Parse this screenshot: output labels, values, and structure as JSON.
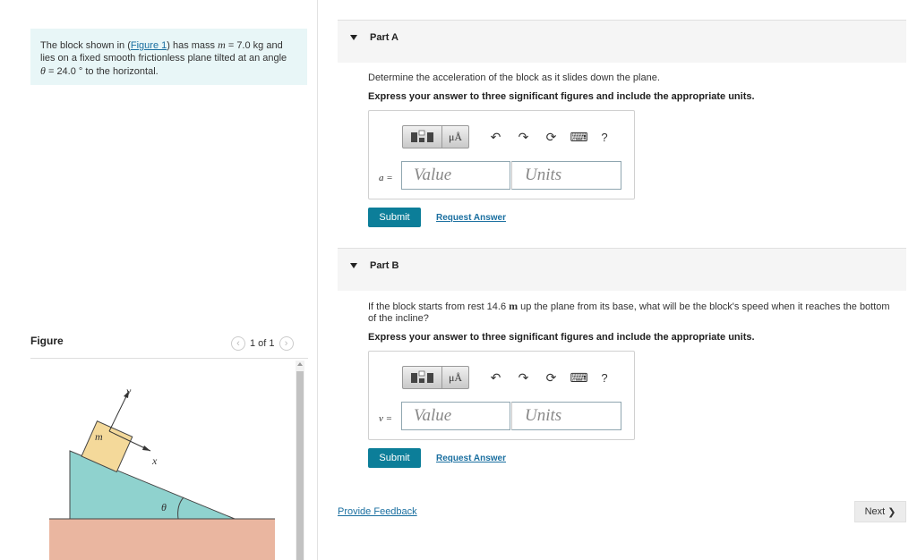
{
  "intro": {
    "text_before_link": "The block shown in (",
    "link": "Figure 1",
    "text_after_link": ") has mass ",
    "mass_symbol": "m",
    "mass_value": " = 7.0 kg and",
    "line2": "lies on a fixed smooth frictionless plane tilted at an angle",
    "theta_symbol": "θ",
    "line3_rest": " = 24.0 ° to the horizontal."
  },
  "figure": {
    "title": "Figure",
    "pager": "1 of 1",
    "labels": {
      "y": "y",
      "x": "x",
      "m": "m",
      "theta": "θ"
    },
    "colors": {
      "incline": "#8fd2ce",
      "block": "#f4d99a",
      "ground": "#eab6a0"
    }
  },
  "part_a": {
    "label": "Part A",
    "question": "Determine the acceleration of the block as it slides down the plane.",
    "instruction": "Express your answer to three significant figures and include the appropriate units.",
    "variable": "a =",
    "value_placeholder": "Value",
    "units_placeholder": "Units",
    "submit": "Submit",
    "request": "Request Answer"
  },
  "part_b": {
    "label": "Part B",
    "question_before": "If the block starts from rest 14.6 ",
    "question_unit": "m",
    "question_after": " up the plane from its base, what will be the block's speed when it reaches the bottom",
    "question_line2": "of the incline?",
    "instruction": "Express your answer to three significant figures and include the appropriate units.",
    "variable": "v =",
    "value_placeholder": "Value",
    "units_placeholder": "Units",
    "submit": "Submit",
    "request": "Request Answer"
  },
  "toolbar": {
    "mu": "μÅ",
    "undo": "↶",
    "redo": "↷",
    "reset": "⟳",
    "keyboard": "⌨",
    "help": "?"
  },
  "footer": {
    "feedback": "Provide Feedback",
    "next": "Next",
    "next_icon": "❯"
  }
}
